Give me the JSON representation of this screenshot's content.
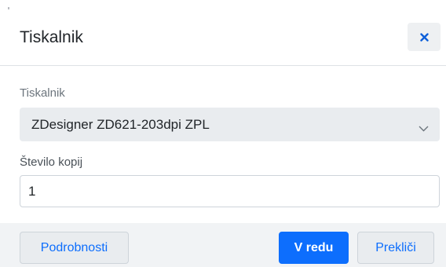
{
  "dialog": {
    "title": "Tiskalnik",
    "close_icon": "close-icon"
  },
  "form": {
    "printer_label": "Tiskalnik",
    "printer_selected": "ZDesigner ZD621-203dpi ZPL",
    "printer_icon": "chevron-down-icon",
    "copies_label": "Število kopij",
    "copies_value": "1"
  },
  "footer": {
    "details_label": "Podrobnosti",
    "ok_label": "V redu",
    "cancel_label": "Prekliči"
  },
  "colors": {
    "primary": "#0d6efd",
    "secondary_bg": "#e9ecef",
    "footer_bg": "#f1f3f5",
    "text": "#212529"
  }
}
